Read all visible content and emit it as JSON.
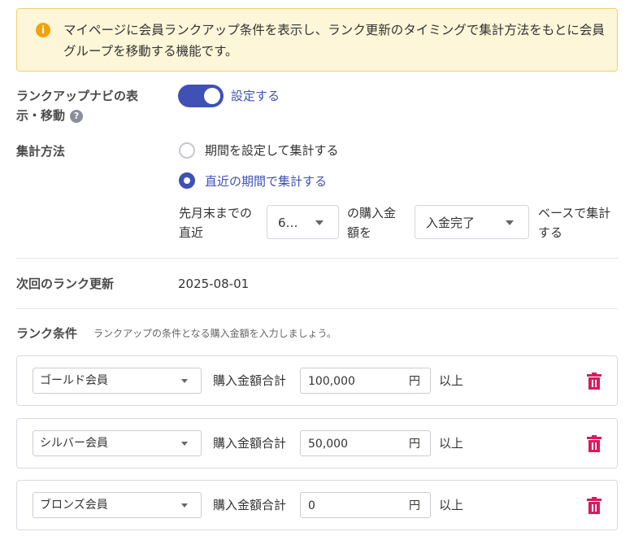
{
  "notice": {
    "text": "マイページに会員ランクアップ条件を表示し、ランク更新のタイミングで集計方法をもとに会員グループを移動する機能です。"
  },
  "rank_navi": {
    "label_line1": "ランクアップナビの表",
    "label_line2": "示・移動",
    "help": "?",
    "toggle_label": "設定する",
    "enabled": true
  },
  "aggregation": {
    "label": "集計方法",
    "options": [
      {
        "label": "期間を設定して集計する",
        "checked": false
      },
      {
        "label": "直近の期間で集計する",
        "checked": true
      }
    ],
    "sentence": {
      "prefix_line1": "先月末までの",
      "prefix_line2": "直近",
      "period_value": "6…",
      "middle_line1": "の購入金",
      "middle_line2": "額を",
      "status_value": "入金完了",
      "suffix_line1": "ベースで集計",
      "suffix_line2": "する"
    }
  },
  "next_update": {
    "label": "次回のランク更新",
    "value": "2025-08-01"
  },
  "rank_conditions": {
    "label": "ランク条件",
    "hint": "ランクアップの条件となる購入金額を入力しましょう。",
    "field_label": "購入金額合計",
    "unit": "円",
    "suffix": "以上",
    "items": [
      {
        "rank": "ゴールド会員",
        "amount": "100,000"
      },
      {
        "rank": "シルバー会員",
        "amount": "50,000"
      },
      {
        "rank": "ブロンズ会員",
        "amount": "0"
      }
    ]
  },
  "colors": {
    "accent": "#3f51b5",
    "notice_bg": "#fdf6d8",
    "notice_border": "#f5cf6a",
    "info_icon": "#f0a30a",
    "delete": "#d81b60"
  }
}
